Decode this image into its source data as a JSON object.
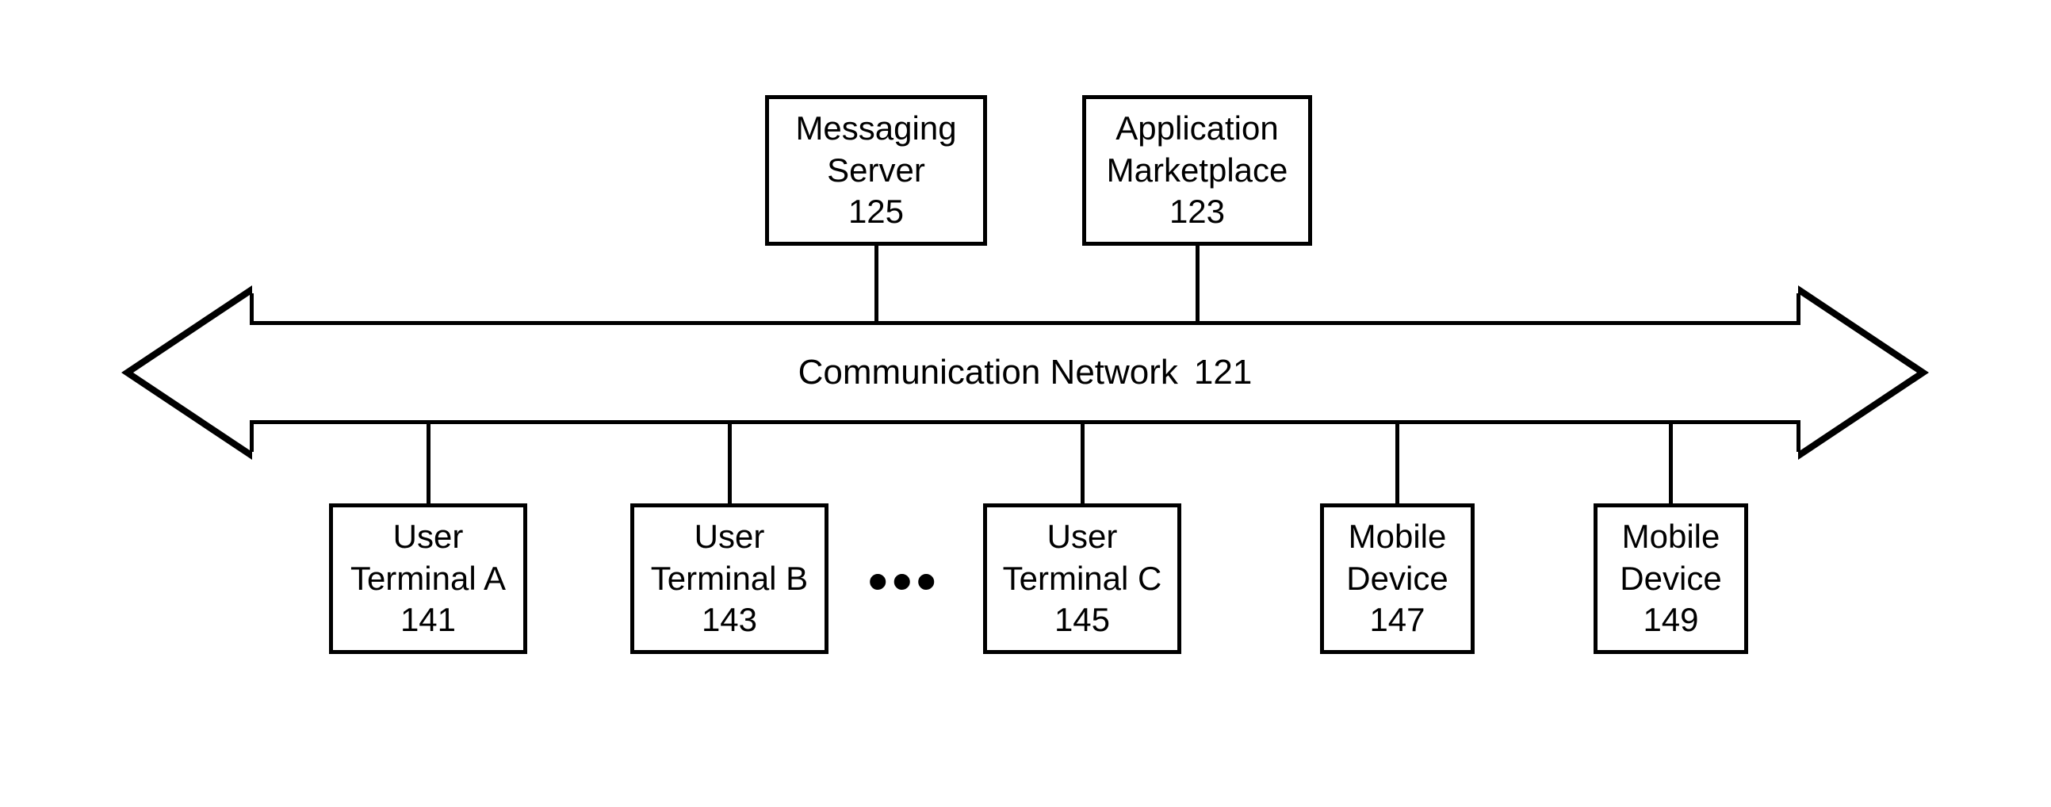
{
  "top": {
    "messaging": {
      "l1": "Messaging",
      "l2": "Server",
      "num": "125"
    },
    "marketplace": {
      "l1": "Application",
      "l2": "Marketplace",
      "num": "123"
    }
  },
  "bus": {
    "label": "Communication Network",
    "num": "121"
  },
  "bottom": {
    "a": {
      "l1": "User",
      "l2": "Terminal A",
      "num": "141"
    },
    "b": {
      "l1": "User",
      "l2": "Terminal B",
      "num": "143"
    },
    "c": {
      "l1": "User",
      "l2": "Terminal C",
      "num": "145"
    },
    "m1": {
      "l1": "Mobile",
      "l2": "Device",
      "num": "147"
    },
    "m2": {
      "l1": "Mobile",
      "l2": "Device",
      "num": "149"
    },
    "ellipsis": "•••"
  }
}
